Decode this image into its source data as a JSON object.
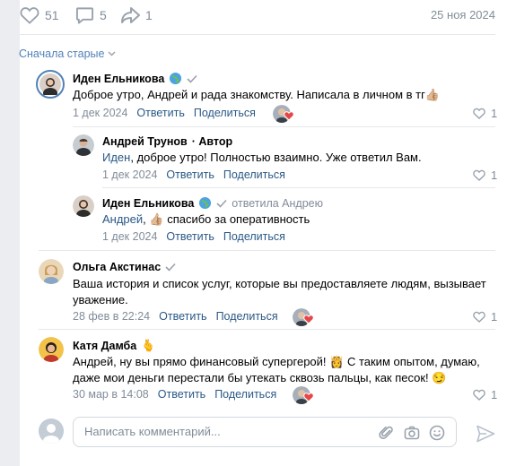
{
  "stats": {
    "likes": "51",
    "comments": "5",
    "shares": "1",
    "date": "25 ноя 2024"
  },
  "sort": {
    "label": "Сначала старые"
  },
  "comments": [
    {
      "name": "Иден Ельникова",
      "text": "Доброе утро, Андрей и рада знакомству. Написала в личном в тг👍🏼",
      "date": "1 дек 2024",
      "reply": "Ответить",
      "share": "Поделиться",
      "likes": "1"
    },
    {
      "name": "Андрей Трунов",
      "author": "· Автор",
      "mention": "Иден",
      "text": ", доброе утро! Полностью взаимно. Уже ответил Вам.",
      "date": "1 дек 2024",
      "reply": "Ответить",
      "share": "Поделиться",
      "likes": "1"
    },
    {
      "name": "Иден Ельникова",
      "reply_to": "ответила Андрею",
      "mention": "Андрей",
      "text": ", 👍🏼 спасибо за оперативность",
      "date": "1 дек 2024",
      "reply": "Ответить",
      "share": "Поделиться"
    },
    {
      "name": "Ольга Акстинас",
      "text": "Ваша история и список услуг, которые вы предоставляете людям, вызывает уважение.",
      "date": "28 фев в 22:24",
      "reply": "Ответить",
      "share": "Поделиться",
      "likes": "1"
    },
    {
      "name": "Катя Дамба",
      "name_emoji": "🫰",
      "text": "Андрей, ну вы прямо финансовый супергерой! 👸 С таким опытом, думаю, даже мои деньги перестали бы утекать сквозь пальцы, как песок! 😏",
      "date": "30 мар в 14:08",
      "reply": "Ответить",
      "share": "Поделиться",
      "likes": "1"
    }
  ],
  "compose": {
    "placeholder": "Написать комментарий..."
  },
  "colors": {
    "link": "#2a5885",
    "muted": "#818c99",
    "accent": "#5181b8",
    "heart": "#e64646"
  },
  "icons": [
    "heart-icon",
    "comment-icon",
    "share-icon",
    "globe-icon",
    "check-icon",
    "attach-icon",
    "camera-icon",
    "smile-icon",
    "send-icon",
    "chevron-down-icon"
  ]
}
